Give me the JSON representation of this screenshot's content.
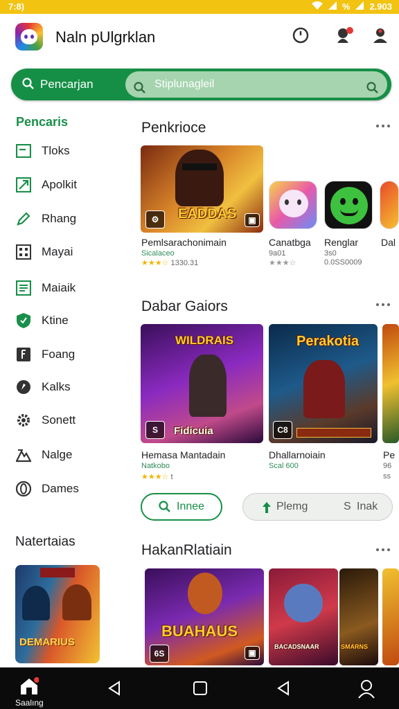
{
  "status": {
    "left": "7:8)",
    "battery": "%",
    "time": "2.903"
  },
  "app": {
    "title": "Naln pUlgrklan"
  },
  "search": {
    "label": "Pencarjan",
    "placeholder": "Stiplunagleil"
  },
  "sidebar": {
    "heading": "Pencaris",
    "items": [
      {
        "label": "Tloks",
        "icon": "screen-icon"
      },
      {
        "label": "Apolkit",
        "icon": "arrow-app-icon"
      },
      {
        "label": "Rhang",
        "icon": "pen-icon"
      },
      {
        "label": "Mayai",
        "icon": "grid-icon"
      },
      {
        "label": "Maiaik",
        "icon": "document-icon"
      },
      {
        "label": "Ktine",
        "icon": "shield-icon"
      },
      {
        "label": "Foang",
        "icon": "book-icon"
      },
      {
        "label": "Kalks",
        "icon": "compass-icon"
      },
      {
        "label": "Sonett",
        "icon": "gear-icon"
      },
      {
        "label": "Nalge",
        "icon": "mountain-icon"
      },
      {
        "label": "Dames",
        "icon": "game-icon"
      }
    ],
    "subheading": "Natertaias",
    "thumb_title": "DEMARIUS"
  },
  "sections": [
    {
      "title": "Penkrioce",
      "feature": {
        "art_title": "EADDAS",
        "name": "Pemlsarachonimain",
        "dev": "Sicalaceo",
        "rating": "1330.31"
      },
      "apps": [
        {
          "name": "Canatbga",
          "sub": "9a01",
          "rating": ""
        },
        {
          "name": "Renglar",
          "sub": "3s0",
          "rating": "0.0SS0009"
        },
        {
          "name": "Dal",
          "sub": "",
          "rating": ""
        }
      ]
    },
    {
      "title": "Dabar Gaiors",
      "cards": [
        {
          "art_title": "WILDRAIS",
          "sub_art": "Fidicuia",
          "badge": "S",
          "name": "Hemasa Mantadain",
          "dev": "Natkobo",
          "rating": "t"
        },
        {
          "art_title": "Perakotia",
          "badge": "C8",
          "name": "Dhallarnoiain",
          "dev": "Scal 600",
          "rating": ""
        },
        {
          "name": "Pe",
          "dev": "96",
          "rating": "ss"
        }
      ],
      "chips": [
        {
          "label": "Innee",
          "icon": "search-icon"
        },
        {
          "label": "Plemg",
          "icon": "arrow-icon"
        },
        {
          "label": "Inak",
          "prefix": "S"
        }
      ]
    },
    {
      "title": "HakanRlatiain",
      "cards": [
        {
          "art_title": "BUAHAUS",
          "badge": "6S"
        },
        {
          "art_title": "BACADSNAAR"
        },
        {
          "art_title": "SMARNS"
        }
      ]
    }
  ],
  "nav": {
    "home_label": "Saalıng"
  },
  "colors": {
    "accent": "#168f46",
    "status_bar": "#f2c311"
  }
}
